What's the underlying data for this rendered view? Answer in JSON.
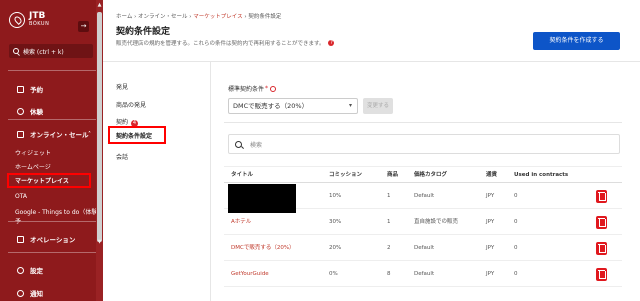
{
  "sidebar": {
    "logo_line1": "JTB",
    "logo_line2": "BÓKUN",
    "collapse": "→",
    "search_label": "検索 (ctrl + k)",
    "items": [
      {
        "label": "予約"
      },
      {
        "label": "休験"
      },
      {
        "label": "オンライン・セール"
      },
      {
        "label": "ウィジェット"
      },
      {
        "label": "ホームページ"
      },
      {
        "label": "マーケットプレイス"
      },
      {
        "label": "OTA"
      },
      {
        "label": "Google - Things to do（体験予"
      },
      {
        "label": "オペレーション"
      },
      {
        "label": "設定"
      },
      {
        "label": "通知"
      }
    ]
  },
  "header": {
    "breadcrumb": [
      "ホーム",
      "オンライン・セール",
      "マーケットプレイス",
      "契約条件設定"
    ],
    "title": "契約条件設定",
    "subtitle": "販売代理店の規約を管理する。これらの条件は契約内で再利用することができます。",
    "create_button": "契約条件を作成する"
  },
  "submenu": {
    "items": [
      {
        "label": "発見"
      },
      {
        "label": "商品の発見"
      },
      {
        "label": "契約",
        "badge": "4"
      },
      {
        "label": "契約条件設定"
      },
      {
        "label": "会話"
      }
    ]
  },
  "default_terms": {
    "label": "標準契約条件",
    "required_mark": "*",
    "selected": "DMCで販売する（20%）",
    "change_button": "変更する"
  },
  "search": {
    "placeholder": "検索"
  },
  "table": {
    "headers": [
      "タイトル",
      "コミッション",
      "商品",
      "価格カタログ",
      "通貨",
      "Used in contracts"
    ],
    "rows": [
      {
        "title": "",
        "commission": "10%",
        "products": "1",
        "catalog": "Default",
        "currency": "JPY",
        "used": "0"
      },
      {
        "title": "Aホテル",
        "commission": "30%",
        "products": "1",
        "catalog": "直自施設での販売",
        "currency": "JPY",
        "used": "0"
      },
      {
        "title": "DMCで販売する（20%）",
        "commission": "20%",
        "products": "2",
        "catalog": "Default",
        "currency": "JPY",
        "used": "0"
      },
      {
        "title": "GetYourGuide",
        "commission": "0%",
        "products": "8",
        "catalog": "Default",
        "currency": "JPY",
        "used": "0"
      }
    ]
  },
  "colors": {
    "sidebar": "#8e1a1c",
    "primary_button": "#0d55c8",
    "delete": "#e0181e",
    "highlight": "#ff0000"
  }
}
